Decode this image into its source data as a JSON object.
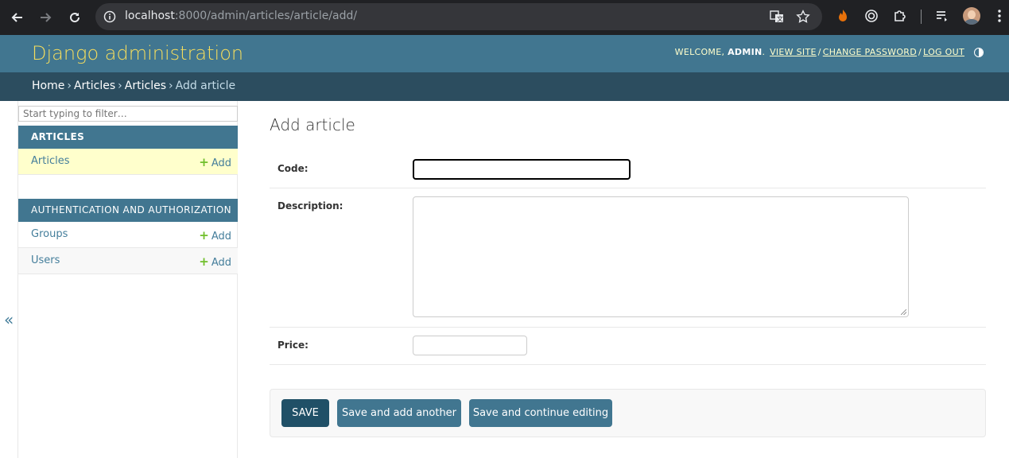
{
  "browser": {
    "url_host": "localhost",
    "url_rest": ":8000/admin/articles/article/add/"
  },
  "header": {
    "branding": "Django administration",
    "welcome": "WELCOME,",
    "username": "ADMIN",
    "view_site": "VIEW SITE",
    "change_password": "CHANGE PASSWORD",
    "log_out": "LOG OUT"
  },
  "breadcrumbs": {
    "home": "Home",
    "app": "Articles",
    "model": "Articles",
    "current": "Add article"
  },
  "sidebar": {
    "filter_placeholder": "Start typing to filter…",
    "modules": [
      {
        "caption": "ARTICLES",
        "models": [
          {
            "name": "Articles",
            "add": "Add"
          }
        ]
      },
      {
        "caption": "AUTHENTICATION AND AUTHORIZATION",
        "models": [
          {
            "name": "Groups",
            "add": "Add"
          },
          {
            "name": "Users",
            "add": "Add"
          }
        ]
      }
    ],
    "collapse": "«"
  },
  "content": {
    "title": "Add article",
    "fields": [
      {
        "label": "Code:",
        "value": ""
      },
      {
        "label": "Description:",
        "value": ""
      },
      {
        "label": "Price:",
        "value": ""
      }
    ]
  },
  "submit": {
    "save": "SAVE",
    "save_add_another": "Save and add another",
    "save_continue": "Save and continue editing"
  },
  "colors": {
    "header_bg": "#417690",
    "branding": "#f5dd5d",
    "breadcrumbs_bg": "#2c4d5f",
    "current_row": "#ffffcc",
    "add_plus": "#70bf2b",
    "save_button": "#205067"
  }
}
